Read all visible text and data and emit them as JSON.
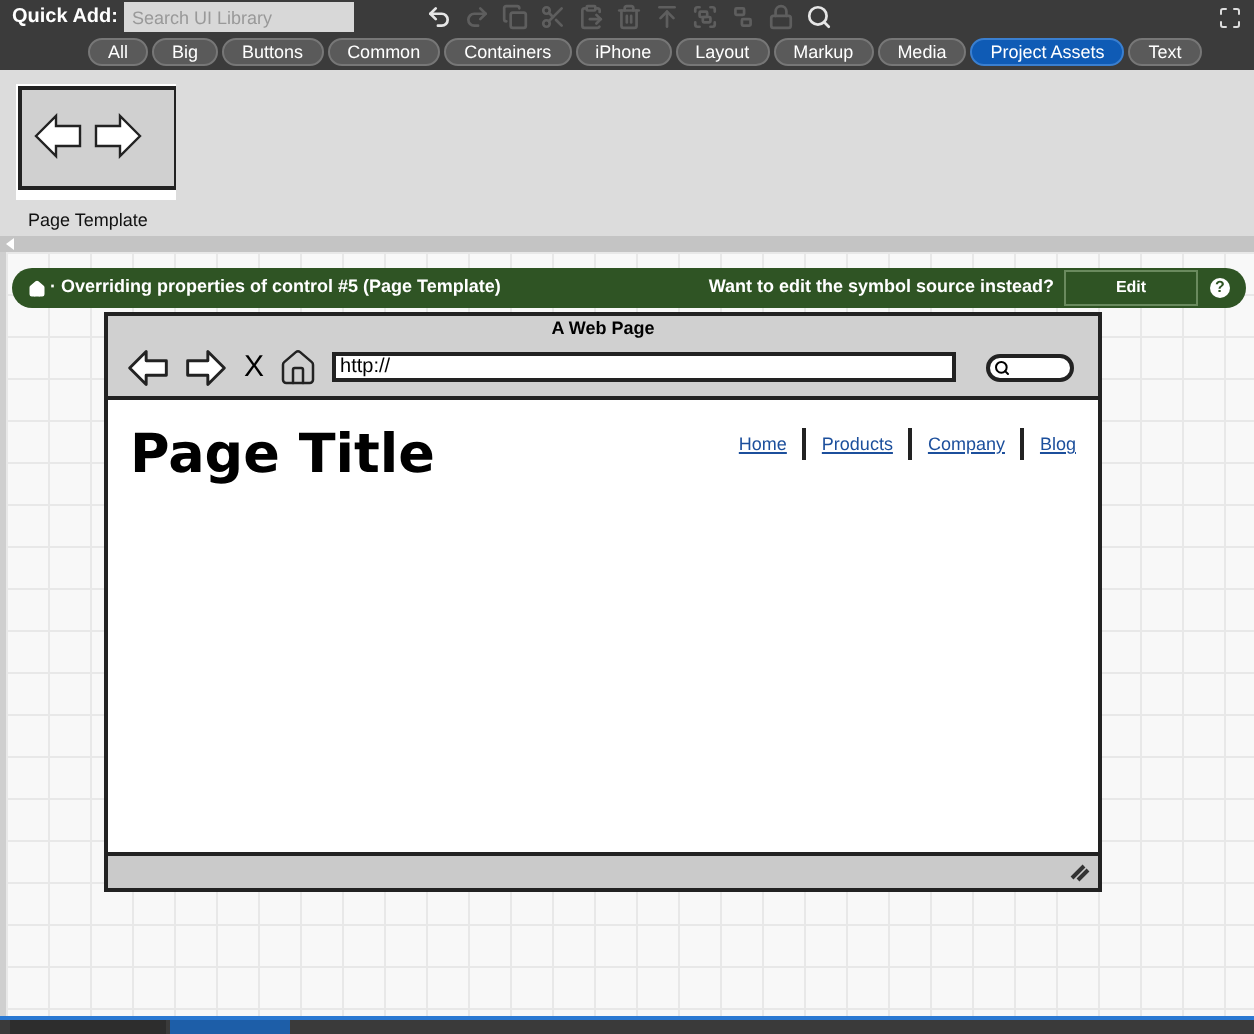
{
  "toolbar": {
    "quick_add_label": "Quick Add:",
    "search": {
      "placeholder": "Search UI Library"
    }
  },
  "categories": [
    {
      "label": "All",
      "selected": false
    },
    {
      "label": "Big",
      "selected": false
    },
    {
      "label": "Buttons",
      "selected": false
    },
    {
      "label": "Common",
      "selected": false
    },
    {
      "label": "Containers",
      "selected": false
    },
    {
      "label": "iPhone",
      "selected": false
    },
    {
      "label": "Layout",
      "selected": false
    },
    {
      "label": "Markup",
      "selected": false
    },
    {
      "label": "Media",
      "selected": false
    },
    {
      "label": "Project Assets",
      "selected": true
    },
    {
      "label": "Text",
      "selected": false
    }
  ],
  "assets": [
    {
      "label": "Page Template"
    }
  ],
  "notice": {
    "message": "· Overriding properties of control #5 (Page Template)",
    "prompt": "Want to edit the symbol source instead?",
    "button": "Edit",
    "help": "?"
  },
  "mockup": {
    "title": "A Web Page",
    "close_glyph": "X",
    "url": "http://",
    "page_title": "Page Title",
    "links": [
      "Home",
      "Products",
      "Company",
      "Blog"
    ]
  }
}
